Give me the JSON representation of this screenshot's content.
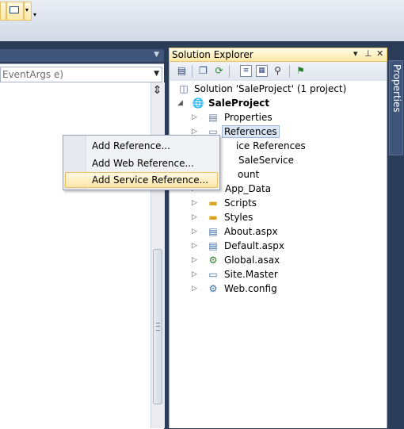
{
  "editor": {
    "member_combo_value": "EventArgs e)"
  },
  "solution_explorer": {
    "title": "Solution Explorer",
    "title_controls": [
      "▾",
      "⊥",
      "✕"
    ],
    "toolbar_icons": [
      "properties-icon",
      "show-all-files-icon",
      "refresh-icon",
      "view-code-icon",
      "view-designer-icon",
      "copy-website-icon",
      "class-diagram-icon"
    ],
    "tree": [
      {
        "label": "Solution 'SaleProject' (1 project)",
        "icon": "solution-icon",
        "level": 0,
        "expander": ""
      },
      {
        "label": "SaleProject",
        "icon": "web-project-icon",
        "level": 1,
        "expander": "◢",
        "bold": true
      },
      {
        "label": "Properties",
        "icon": "properties-folder-icon",
        "level": 2,
        "expander": "▷"
      },
      {
        "label": "References",
        "icon": "references-folder-icon",
        "level": 2,
        "expander": "▷",
        "selected": true
      },
      {
        "label": "ice References",
        "icon": "",
        "level": 2,
        "expander": "▷"
      },
      {
        "label": "SaleService",
        "icon": "",
        "level": 2,
        "expander": "▷"
      },
      {
        "label": "ount",
        "icon": "",
        "level": 2,
        "expander": "▷"
      },
      {
        "label": "App_Data",
        "icon": "",
        "level": 2,
        "expander": "▷"
      },
      {
        "label": "Scripts",
        "icon": "folder-icon",
        "level": 2,
        "expander": "▷"
      },
      {
        "label": "Styles",
        "icon": "folder-icon",
        "level": 2,
        "expander": "▷"
      },
      {
        "label": "About.aspx",
        "icon": "aspx-page-icon",
        "level": 2,
        "expander": "▷"
      },
      {
        "label": "Default.aspx",
        "icon": "aspx-page-icon",
        "level": 2,
        "expander": "▷"
      },
      {
        "label": "Global.asax",
        "icon": "global-asax-icon",
        "level": 2,
        "expander": "▷"
      },
      {
        "label": "Site.Master",
        "icon": "master-page-icon",
        "level": 2,
        "expander": "▷"
      },
      {
        "label": "Web.config",
        "icon": "web-config-icon",
        "level": 2,
        "expander": "▷"
      }
    ]
  },
  "properties_tab": {
    "label": "Properties"
  },
  "context_menu": {
    "items": [
      {
        "label": "Add Reference...",
        "highlighted": false
      },
      {
        "label": "Add Web Reference...",
        "highlighted": false
      },
      {
        "label": "Add Service Reference...",
        "highlighted": true
      }
    ]
  }
}
